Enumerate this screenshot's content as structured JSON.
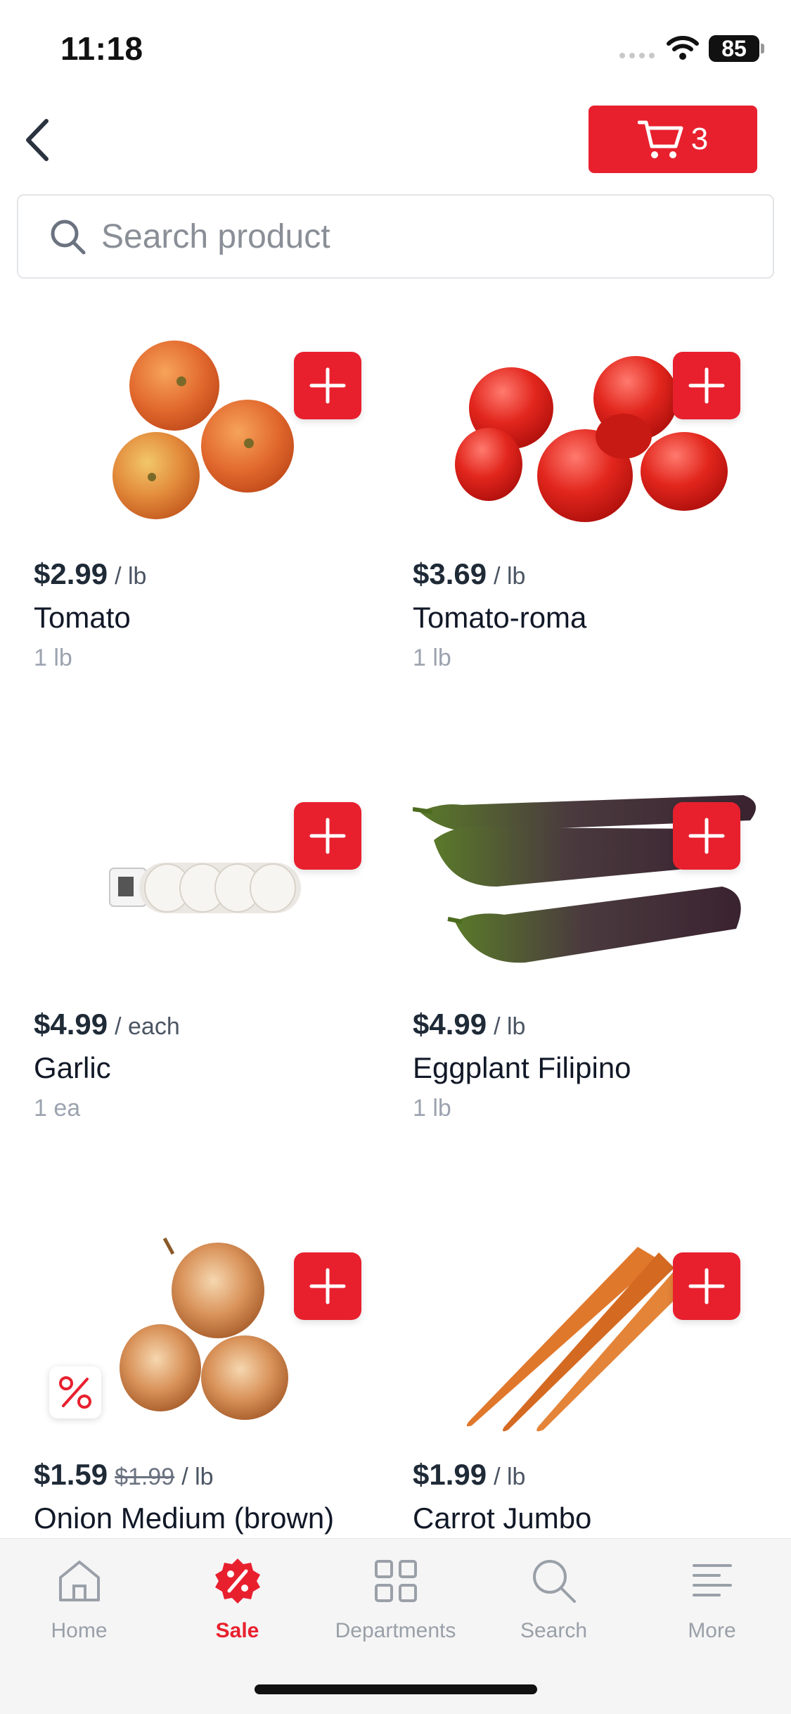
{
  "status_bar": {
    "time": "11:18",
    "battery": "85"
  },
  "header": {
    "cart_count": "3"
  },
  "search": {
    "placeholder": "Search product"
  },
  "products": [
    {
      "name": "Tomato",
      "price": "$2.99",
      "unit": "/ lb",
      "size": "1 lb"
    },
    {
      "name": "Tomato-roma",
      "price": "$3.69",
      "unit": "/ lb",
      "size": "1 lb"
    },
    {
      "name": "Garlic",
      "price": "$4.99",
      "unit": "/ each",
      "size": "1 ea"
    },
    {
      "name": "Eggplant Filipino",
      "price": "$4.99",
      "unit": "/ lb",
      "size": "1 lb"
    },
    {
      "name": "Onion Medium (brown)",
      "price": "$1.59",
      "old_price": "$1.99",
      "unit": "/ lb",
      "on_sale": true
    },
    {
      "name": "Carrot Jumbo",
      "price": "$1.99",
      "unit": "/ lb"
    }
  ],
  "tabs": [
    {
      "label": "Home",
      "icon": "home-icon"
    },
    {
      "label": "Sale",
      "icon": "sale-icon",
      "active": true
    },
    {
      "label": "Departments",
      "icon": "grid-icon"
    },
    {
      "label": "Search",
      "icon": "search-icon"
    },
    {
      "label": "More",
      "icon": "menu-icon"
    }
  ],
  "colors": {
    "accent": "#e8202e",
    "text": "#1f2a37",
    "muted": "#9ca3af"
  }
}
